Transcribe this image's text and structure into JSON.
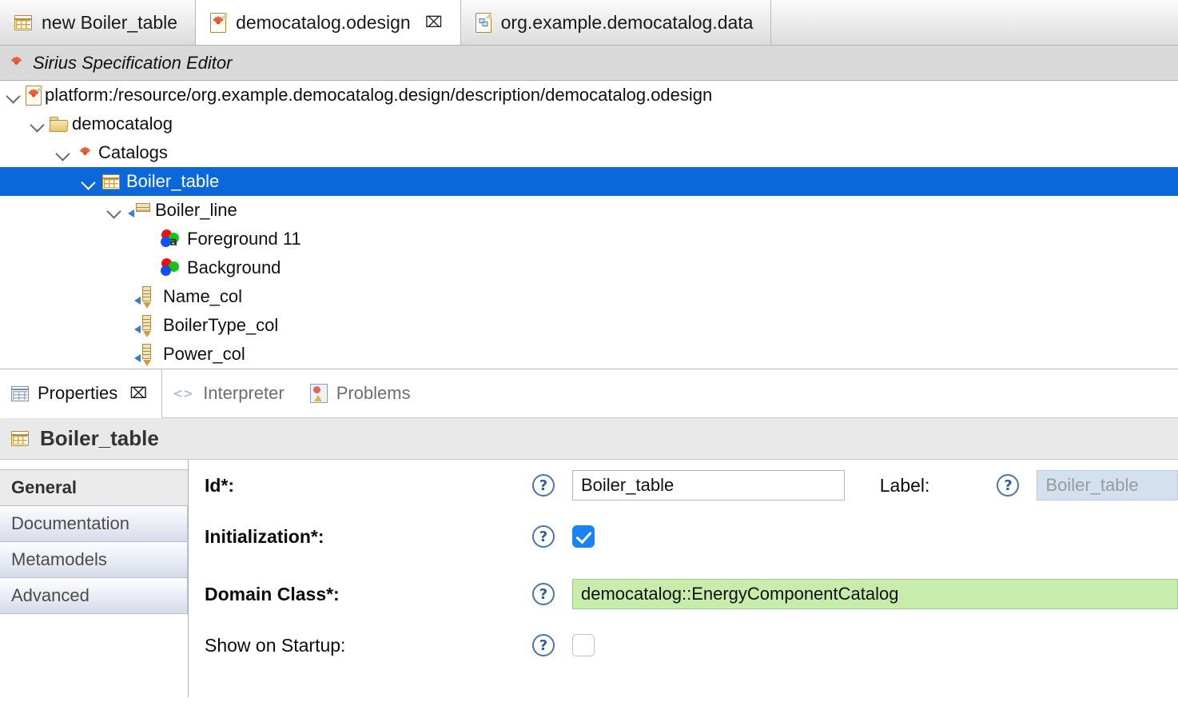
{
  "editor_tabs": [
    {
      "label": "new Boiler_table",
      "icon": "table-icon",
      "active": false,
      "closable": false
    },
    {
      "label": "democatalog.odesign",
      "icon": "sirius-doc-icon",
      "active": true,
      "closable": true,
      "close_glyph": "⌧"
    },
    {
      "label": "org.example.democatalog.data",
      "icon": "ecore-doc-icon",
      "active": false,
      "closable": false
    }
  ],
  "editor_header": {
    "title": "Sirius Specification Editor",
    "icon": "sirius-icon"
  },
  "tree": [
    {
      "label": "platform:/resource/org.example.democatalog.design/description/democatalog.odesign",
      "depth": 0,
      "expanded": true,
      "icon": "sirius-doc-icon",
      "selected": false
    },
    {
      "label": "democatalog",
      "depth": 1,
      "expanded": true,
      "icon": "folder-icon",
      "selected": false
    },
    {
      "label": "Catalogs",
      "depth": 2,
      "expanded": true,
      "icon": "sirius-icon",
      "selected": false
    },
    {
      "label": "Boiler_table",
      "depth": 3,
      "expanded": true,
      "icon": "table-icon",
      "selected": true
    },
    {
      "label": "Boiler_line",
      "depth": 4,
      "expanded": true,
      "icon": "line-icon",
      "selected": false
    },
    {
      "label": "Foreground 11",
      "depth": 5,
      "expanded": null,
      "icon": "foreground-color-icon",
      "selected": false
    },
    {
      "label": "Background",
      "depth": 5,
      "expanded": null,
      "icon": "background-color-icon",
      "selected": false
    },
    {
      "label": "Name_col",
      "depth": 4,
      "expanded": null,
      "icon": "column-icon",
      "selected": false
    },
    {
      "label": "BoilerType_col",
      "depth": 4,
      "expanded": null,
      "icon": "column-icon",
      "selected": false
    },
    {
      "label": "Power_col",
      "depth": 4,
      "expanded": null,
      "icon": "column-icon",
      "selected": false
    }
  ],
  "view_tabs": [
    {
      "label": "Properties",
      "icon": "properties-icon",
      "active": true,
      "closable": true,
      "close_glyph": "⌧"
    },
    {
      "label": "Interpreter",
      "icon": "interpreter-icon",
      "active": false,
      "closable": false,
      "icon_glyph": "<>"
    },
    {
      "label": "Problems",
      "icon": "problems-icon",
      "active": false,
      "closable": false
    }
  ],
  "properties": {
    "title": "Boiler_table",
    "title_icon": "table-icon",
    "tabs": [
      {
        "label": "General",
        "active": true
      },
      {
        "label": "Documentation",
        "active": false
      },
      {
        "label": "Metamodels",
        "active": false
      },
      {
        "label": "Advanced",
        "active": false
      }
    ],
    "fields": [
      {
        "label": "Id*:",
        "required": true,
        "type": "text",
        "value": "Boiler_table",
        "help": "?",
        "secondary_label": "Label:",
        "secondary_help": "?",
        "secondary_value": "Boiler_table",
        "secondary_readonly": true
      },
      {
        "label": "Initialization*:",
        "required": true,
        "type": "checkbox",
        "checked": true,
        "help": "?"
      },
      {
        "label": "Domain Class*:",
        "required": true,
        "type": "text-green",
        "value": "democatalog::EnergyComponentCatalog",
        "help": "?"
      },
      {
        "label": "Show on Startup:",
        "required": false,
        "type": "checkbox",
        "checked": false,
        "help": "?"
      }
    ]
  },
  "colors": {
    "selection_blue": "#0a68da",
    "domain_class_green": "#c8ecab",
    "readonly_blue": "#d3e0f0",
    "checkbox_blue": "#1a82f7",
    "header_gray": "#d9d9d9"
  }
}
